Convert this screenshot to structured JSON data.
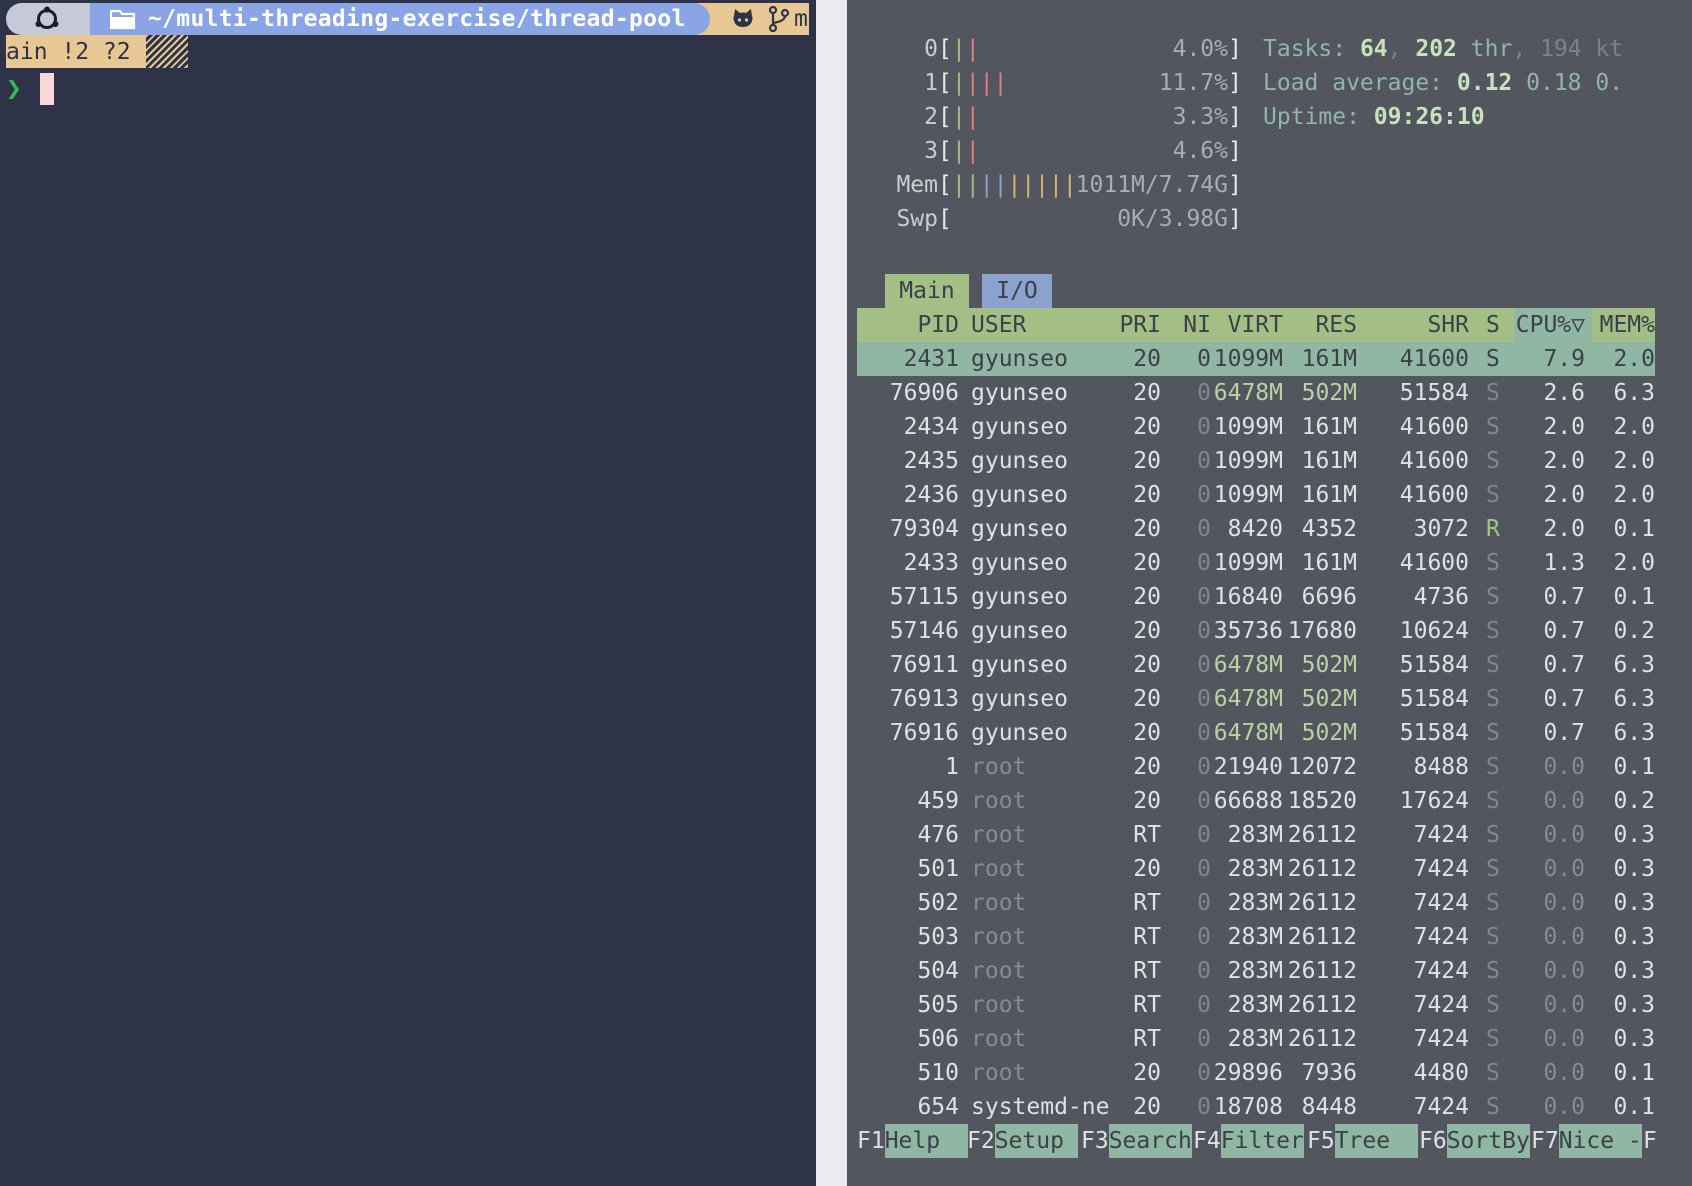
{
  "shell": {
    "path": "~/multi-threading-exercise/thread-pool",
    "git_head": "m",
    "git_status": "ain !2 ?2",
    "prompt_symbol": "❯",
    "icons": [
      "os-logo-icon",
      "folder-icon",
      "github-icon",
      "git-branch-icon"
    ]
  },
  "htop": {
    "meters": [
      {
        "label": "0",
        "bars": "||",
        "value": "4.0%"
      },
      {
        "label": "1",
        "bars": "||||",
        "value": "11.7%"
      },
      {
        "label": "2",
        "bars": "||",
        "value": "3.3%"
      },
      {
        "label": "3",
        "bars": "||",
        "value": "4.6%"
      },
      {
        "label": "Mem",
        "bars": "|||||||||",
        "value": "1011M/7.74G"
      },
      {
        "label": "Swp",
        "bars": "",
        "value": "0K/3.98G"
      }
    ],
    "tasks": {
      "label": "Tasks:",
      "count": "64",
      "thr": "202",
      "thr_label": "thr",
      "kt": "194",
      "kt_label": "kt"
    },
    "load": {
      "label": "Load average:",
      "v1": "0.12",
      "v2": "0.18",
      "v3": "0."
    },
    "uptime": {
      "label": "Uptime:",
      "value": "09:26:10"
    },
    "tabs": [
      "Main",
      "I/O"
    ],
    "columns": [
      "PID",
      "USER",
      "PRI",
      "NI",
      "VIRT",
      "RES",
      "SHR",
      "S",
      "CPU%▽",
      "MEM%"
    ],
    "rows": [
      [
        "2431",
        "gyunseo",
        "20",
        "0",
        "1099M",
        "161M",
        "41600",
        "S",
        "7.9",
        "2.0"
      ],
      [
        "76906",
        "gyunseo",
        "20",
        "0",
        "6478M",
        "502M",
        "51584",
        "S",
        "2.6",
        "6.3"
      ],
      [
        "2434",
        "gyunseo",
        "20",
        "0",
        "1099M",
        "161M",
        "41600",
        "S",
        "2.0",
        "2.0"
      ],
      [
        "2435",
        "gyunseo",
        "20",
        "0",
        "1099M",
        "161M",
        "41600",
        "S",
        "2.0",
        "2.0"
      ],
      [
        "2436",
        "gyunseo",
        "20",
        "0",
        "1099M",
        "161M",
        "41600",
        "S",
        "2.0",
        "2.0"
      ],
      [
        "79304",
        "gyunseo",
        "20",
        "0",
        "8420",
        "4352",
        "3072",
        "R",
        "2.0",
        "0.1"
      ],
      [
        "2433",
        "gyunseo",
        "20",
        "0",
        "1099M",
        "161M",
        "41600",
        "S",
        "1.3",
        "2.0"
      ],
      [
        "57115",
        "gyunseo",
        "20",
        "0",
        "16840",
        "6696",
        "4736",
        "S",
        "0.7",
        "0.1"
      ],
      [
        "57146",
        "gyunseo",
        "20",
        "0",
        "35736",
        "17680",
        "10624",
        "S",
        "0.7",
        "0.2"
      ],
      [
        "76911",
        "gyunseo",
        "20",
        "0",
        "6478M",
        "502M",
        "51584",
        "S",
        "0.7",
        "6.3"
      ],
      [
        "76913",
        "gyunseo",
        "20",
        "0",
        "6478M",
        "502M",
        "51584",
        "S",
        "0.7",
        "6.3"
      ],
      [
        "76916",
        "gyunseo",
        "20",
        "0",
        "6478M",
        "502M",
        "51584",
        "S",
        "0.7",
        "6.3"
      ],
      [
        "1",
        "root",
        "20",
        "0",
        "21940",
        "12072",
        "8488",
        "S",
        "0.0",
        "0.1"
      ],
      [
        "459",
        "root",
        "20",
        "0",
        "66688",
        "18520",
        "17624",
        "S",
        "0.0",
        "0.2"
      ],
      [
        "476",
        "root",
        "RT",
        "0",
        "283M",
        "26112",
        "7424",
        "S",
        "0.0",
        "0.3"
      ],
      [
        "501",
        "root",
        "20",
        "0",
        "283M",
        "26112",
        "7424",
        "S",
        "0.0",
        "0.3"
      ],
      [
        "502",
        "root",
        "RT",
        "0",
        "283M",
        "26112",
        "7424",
        "S",
        "0.0",
        "0.3"
      ],
      [
        "503",
        "root",
        "RT",
        "0",
        "283M",
        "26112",
        "7424",
        "S",
        "0.0",
        "0.3"
      ],
      [
        "504",
        "root",
        "RT",
        "0",
        "283M",
        "26112",
        "7424",
        "S",
        "0.0",
        "0.3"
      ],
      [
        "505",
        "root",
        "RT",
        "0",
        "283M",
        "26112",
        "7424",
        "S",
        "0.0",
        "0.3"
      ],
      [
        "506",
        "root",
        "RT",
        "0",
        "283M",
        "26112",
        "7424",
        "S",
        "0.0",
        "0.3"
      ],
      [
        "510",
        "root",
        "20",
        "0",
        "29896",
        "7936",
        "4480",
        "S",
        "0.0",
        "0.1"
      ],
      [
        "654",
        "systemd-ne",
        "20",
        "0",
        "18708",
        "8448",
        "7424",
        "S",
        "0.0",
        "0.1"
      ]
    ],
    "fkeys": [
      {
        "key": "F1",
        "label": "Help  "
      },
      {
        "key": "F2",
        "label": "Setup "
      },
      {
        "key": "F3",
        "label": "Search"
      },
      {
        "key": "F4",
        "label": "Filter"
      },
      {
        "key": "F5",
        "label": "Tree  "
      },
      {
        "key": "F6",
        "label": "SortBy"
      },
      {
        "key": "F7",
        "label": "Nice -"
      },
      {
        "key": "F",
        "label": ""
      }
    ],
    "colors": {
      "selected_row": "#8fb7a4",
      "header": "#a3bf86",
      "io_tab": "#8aa2cd"
    }
  }
}
